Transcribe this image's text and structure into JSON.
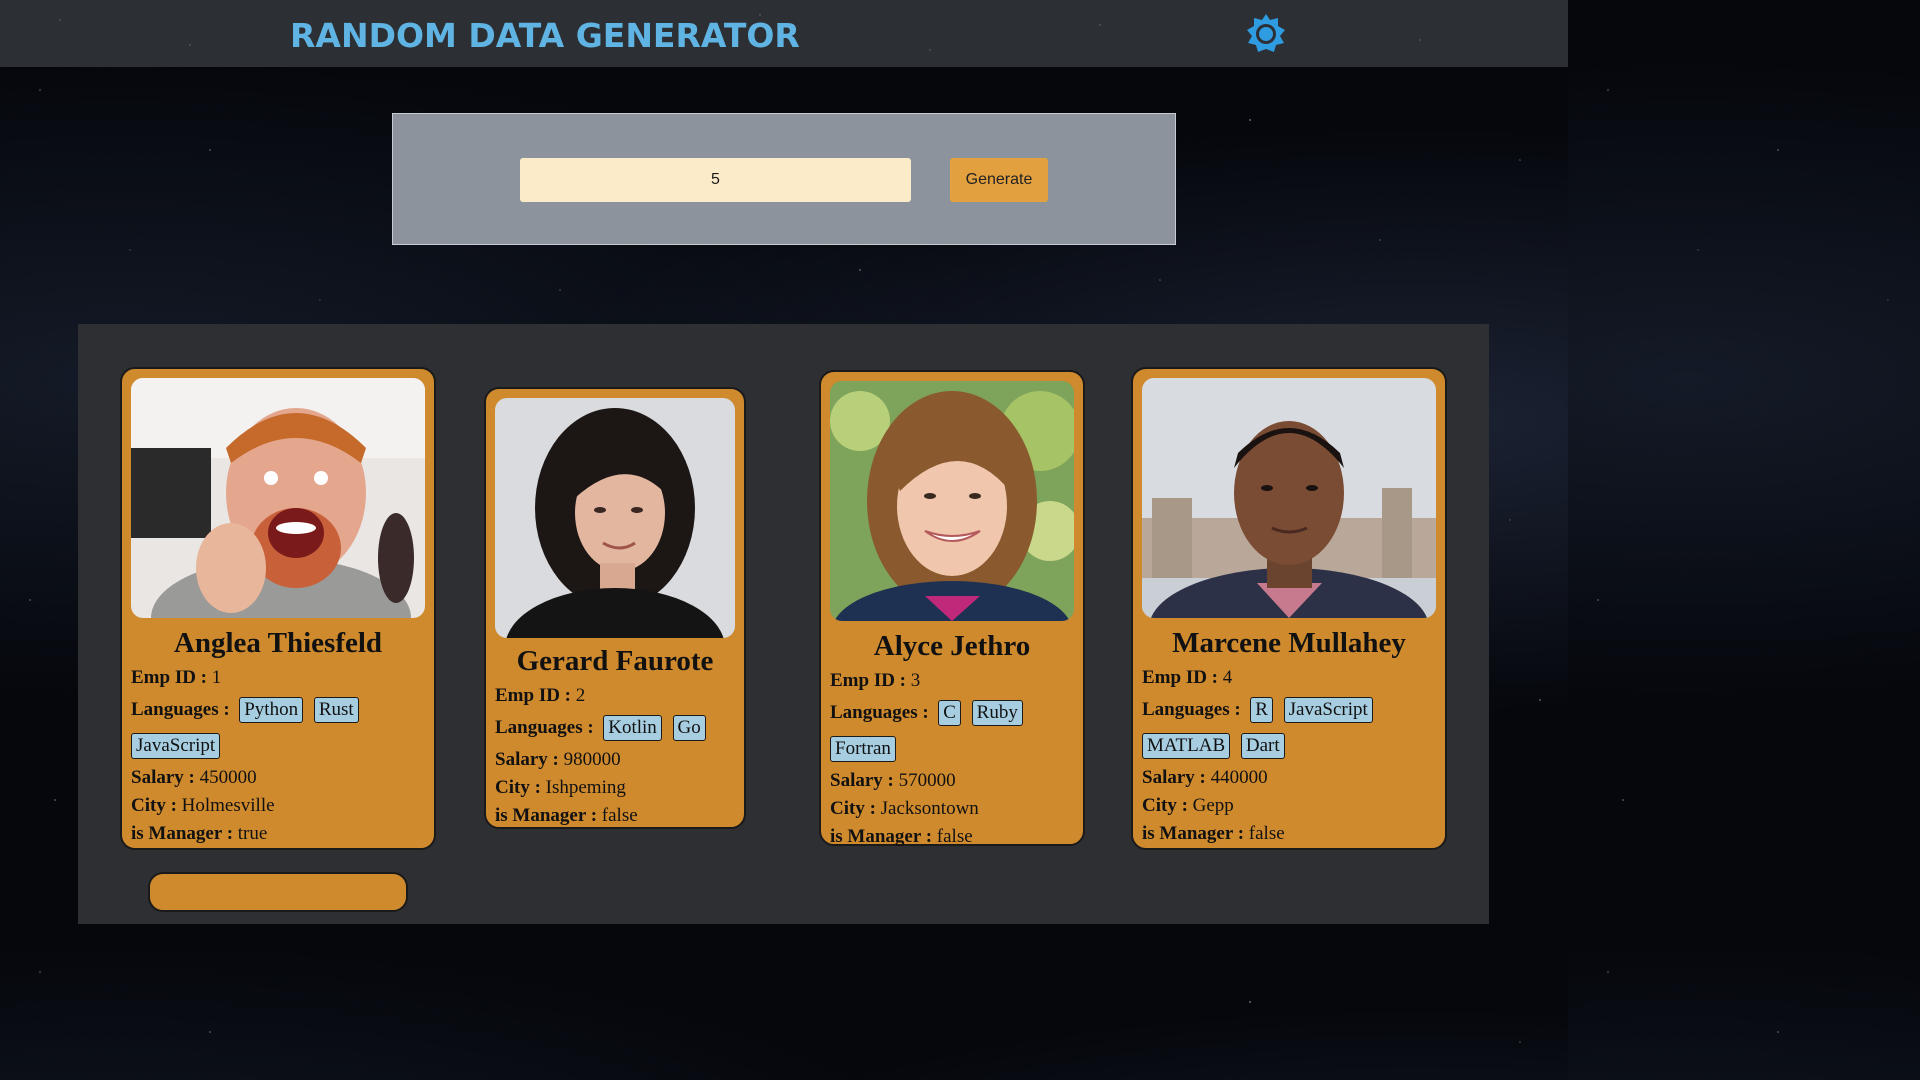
{
  "header": {
    "title": "Random Data Generator",
    "theme_icon": "gear-icon"
  },
  "generator": {
    "count_value": "5",
    "generate_label": "Generate"
  },
  "labels": {
    "emp_id": "Emp ID :",
    "languages": "Languages :",
    "salary": "Salary :",
    "city": "City :",
    "is_manager": "is Manager :"
  },
  "colors": {
    "title": "#5fb4e3",
    "card": "#cf8a2e",
    "tag": "#a7cde0",
    "button": "#e3a03f",
    "input": "#fcebc9"
  },
  "employees": [
    {
      "name": "Anglea Thiesfeld",
      "emp_id": "1",
      "languages": [
        "Python",
        "Rust",
        "JavaScript"
      ],
      "salary": "450000",
      "city": "Holmesville",
      "is_manager": "true"
    },
    {
      "name": "Gerard Faurote",
      "emp_id": "2",
      "languages": [
        "Kotlin",
        "Go"
      ],
      "salary": "980000",
      "city": "Ishpeming",
      "is_manager": "false"
    },
    {
      "name": "Alyce Jethro",
      "emp_id": "3",
      "languages": [
        "C",
        "Ruby",
        "Fortran"
      ],
      "salary": "570000",
      "city": "Jacksontown",
      "is_manager": "false"
    },
    {
      "name": "Marcene Mullahey",
      "emp_id": "4",
      "languages": [
        "R",
        "JavaScript",
        "MATLAB",
        "Dart"
      ],
      "salary": "440000",
      "city": "Gepp",
      "is_manager": "false"
    }
  ]
}
